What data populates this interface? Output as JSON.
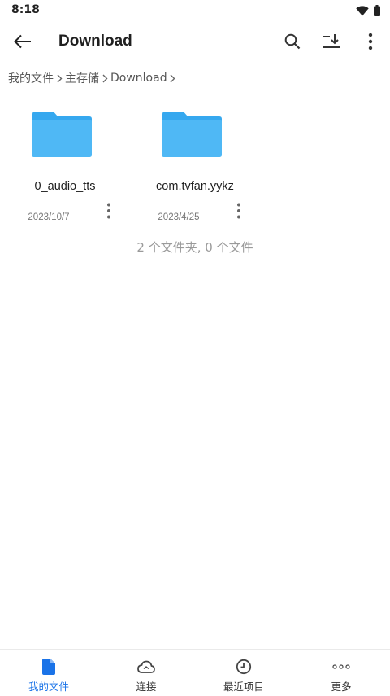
{
  "status": {
    "time": "8:18"
  },
  "header": {
    "title": "Download"
  },
  "breadcrumb": {
    "items": [
      "我的文件",
      "主存储",
      "Download"
    ]
  },
  "files": [
    {
      "name": "0_audio_tts",
      "date": "2023/10/7"
    },
    {
      "name": "com.tvfan.yykz",
      "date": "2023/4/25"
    }
  ],
  "summary": "2 个文件夹, 0 个文件",
  "bottom_nav": {
    "items": [
      {
        "label": "我的文件",
        "icon": "file-icon",
        "active": true
      },
      {
        "label": "连接",
        "icon": "cloud-icon"
      },
      {
        "label": "最近项目",
        "icon": "clock-icon"
      },
      {
        "label": "更多",
        "icon": "more-horizontal-icon"
      }
    ]
  },
  "colors": {
    "accent": "#1a73e8",
    "folder": "#4fb8f5",
    "folder_tab": "#36a8ef"
  }
}
